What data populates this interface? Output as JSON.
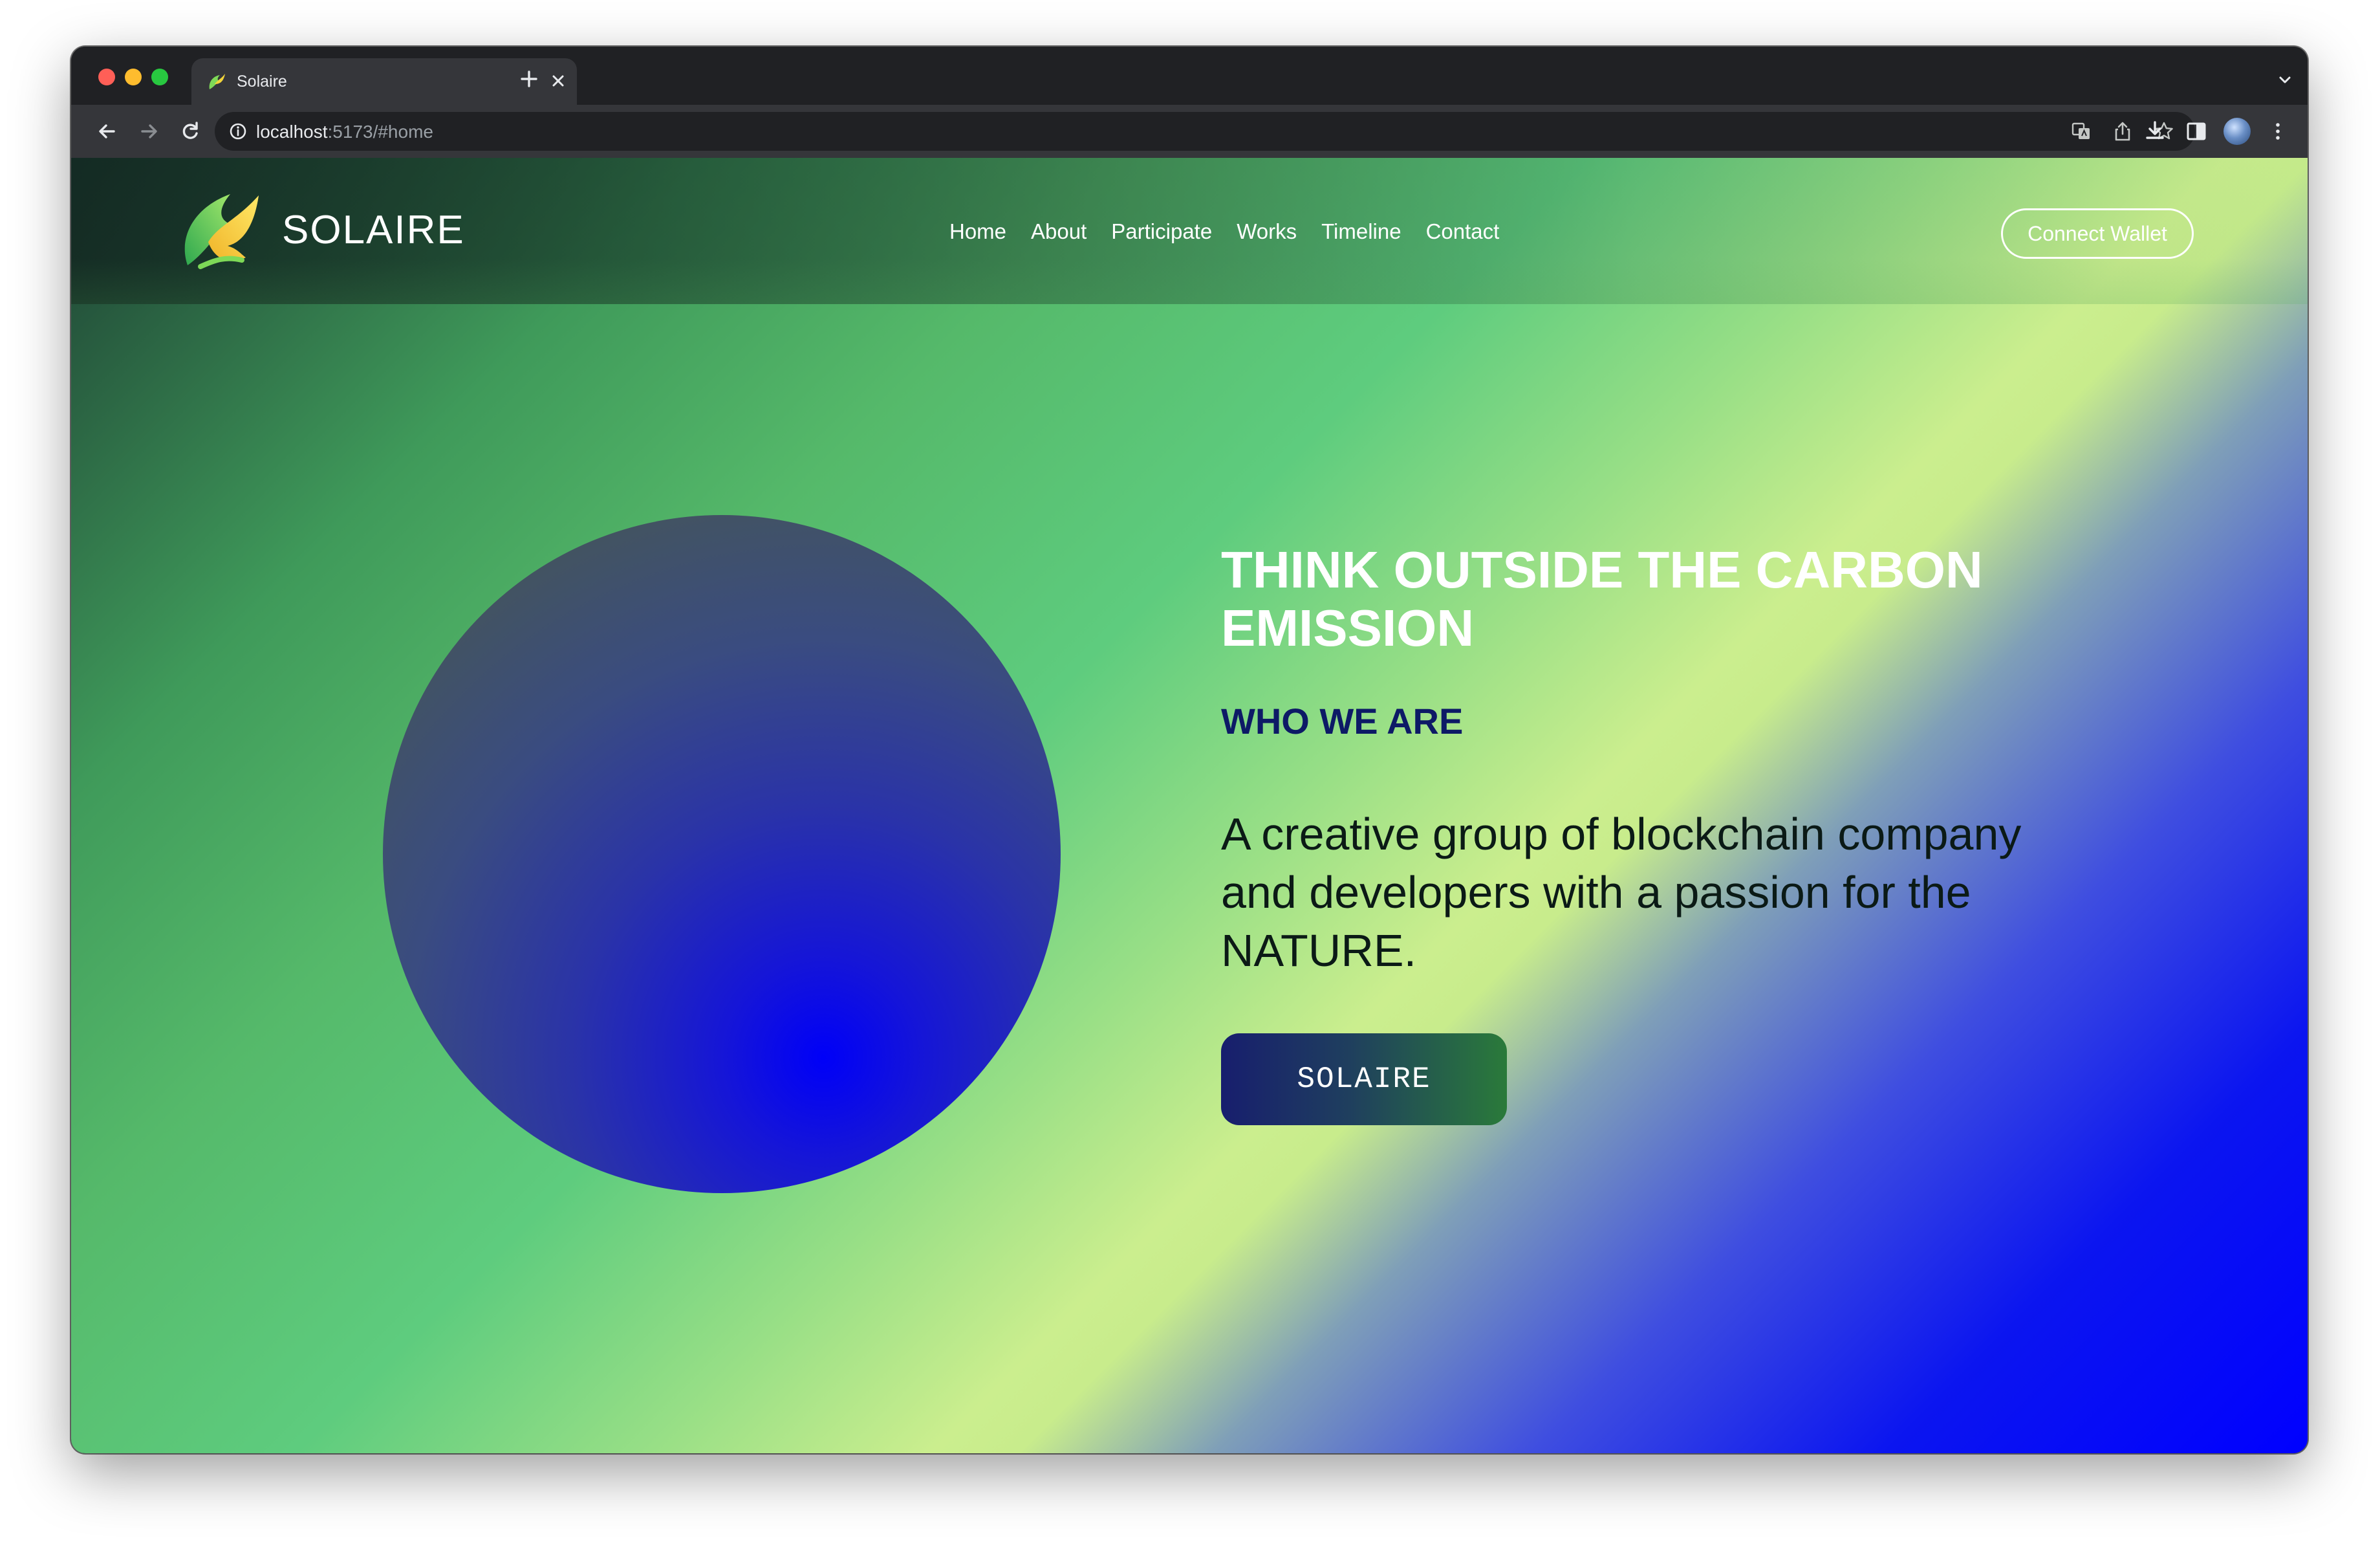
{
  "browser": {
    "tab": {
      "title": "Solaire",
      "favicon": "solaire-leaf-icon"
    },
    "address_bar": {
      "host": "localhost",
      "rest": ":5173/#home"
    },
    "icons": [
      "back-icon",
      "forward-icon",
      "reload-icon",
      "info-icon",
      "translate-icon",
      "share-icon",
      "star-icon",
      "download-icon",
      "sidepanel-icon",
      "profile-avatar",
      "menu-icon"
    ]
  },
  "site": {
    "brand": "SOLAIRE",
    "nav": [
      {
        "label": "Home"
      },
      {
        "label": "About"
      },
      {
        "label": "Participate"
      },
      {
        "label": "Works"
      },
      {
        "label": "Timeline"
      },
      {
        "label": "Contact"
      }
    ],
    "wallet_button": "Connect Wallet"
  },
  "hero": {
    "headline": "THINK OUTSIDE THE CARBON EMISSION",
    "eyebrow": "WHO WE ARE",
    "lead": "A creative group of blockchain company and developers with a passion for the NATURE.",
    "cta": "SOLAIRE"
  },
  "colors": {
    "eyebrow": "#0d1a66",
    "accent_green": "#5ecc7e",
    "accent_blue": "#0000ff",
    "browser_chrome": "#202124"
  }
}
